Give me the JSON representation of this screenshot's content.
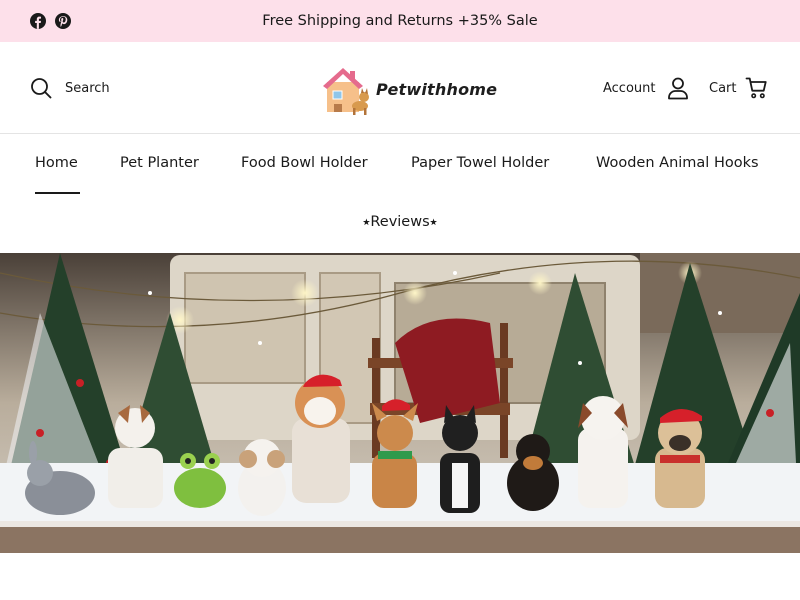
{
  "announcement": {
    "text": "Free Shipping and Returns +35% Sale",
    "background": "#fde0ea"
  },
  "social_icons": [
    "facebook-icon",
    "pinterest-icon"
  ],
  "header": {
    "search_label": "Search",
    "logo_text": "Petwithhome",
    "account_label": "Account",
    "cart_label": "Cart"
  },
  "nav": {
    "items": [
      {
        "label": "Home",
        "active": true
      },
      {
        "label": "Pet Planter"
      },
      {
        "label": "Food Bowl Holder"
      },
      {
        "label": "Paper Towel Holder"
      },
      {
        "label": "Wooden Animal Hooks"
      }
    ],
    "reviews_label": "⭑Reviews⭑"
  },
  "colors": {
    "accent": "#1a1a1a",
    "logo_roof": "#e56b8d",
    "logo_house": "#f6c08a",
    "hat_red": "#d6202a",
    "snow": "#f5f7f9"
  }
}
